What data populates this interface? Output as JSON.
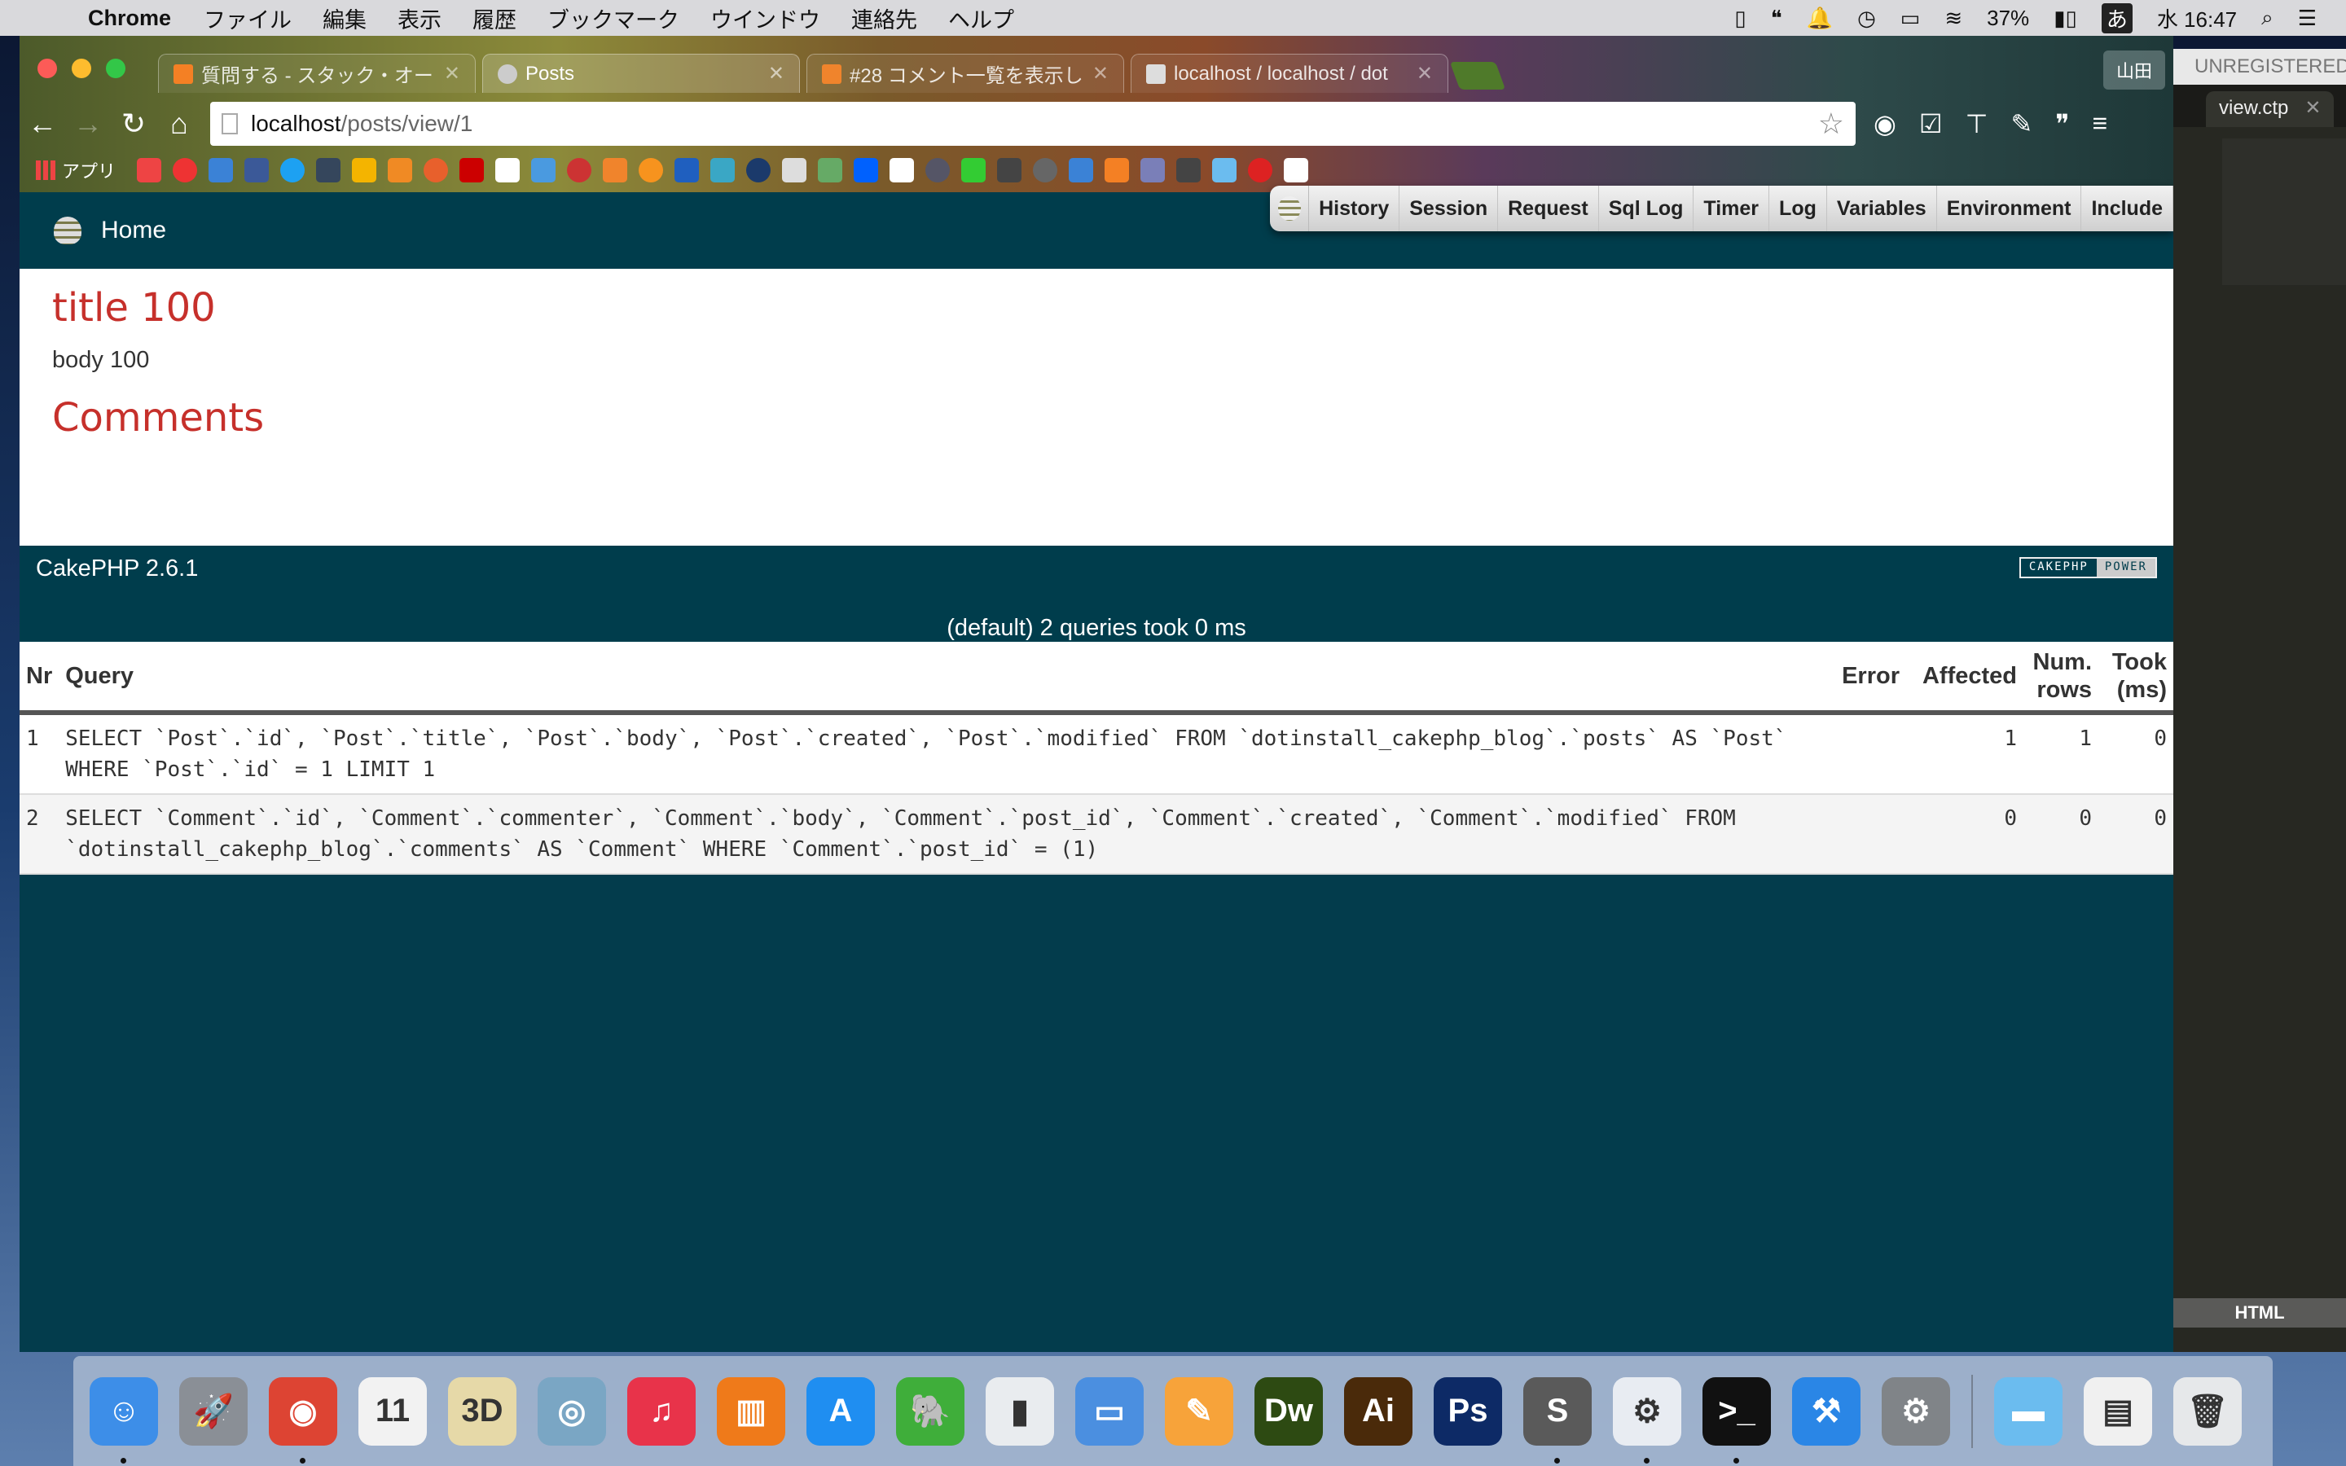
{
  "menubar": {
    "app_name": "Chrome",
    "items": [
      "ファイル",
      "編集",
      "表示",
      "履歴",
      "ブックマーク",
      "ウインドウ",
      "連絡先",
      "ヘルプ"
    ],
    "battery": "37%",
    "input_method": "あ",
    "clock": "水 16:47"
  },
  "browser": {
    "tabs": [
      {
        "title": "質問する - スタック・オー",
        "favicon_color": "#f48024",
        "active": false
      },
      {
        "title": "Posts",
        "favicon_color": "#cccccc",
        "active": true
      },
      {
        "title": "#28 コメント一覧を表示し",
        "favicon_color": "#f0842c",
        "active": false
      },
      {
        "title": "localhost / localhost / dot",
        "favicon_color": "#dddddd",
        "active": false
      }
    ],
    "profile_name": "山田",
    "url_host": "localhost",
    "url_path": "/posts/view/1",
    "bookmarks_apps_label": "アプリ"
  },
  "page": {
    "home_link": "Home",
    "debug_toolbar": [
      "History",
      "Session",
      "Request",
      "Sql Log",
      "Timer",
      "Log",
      "Variables",
      "Environment",
      "Include"
    ],
    "post_title": "title 100",
    "post_body": "body 100",
    "comments_heading": "Comments",
    "footer_version": "CakePHP 2.6.1",
    "power_badge": [
      "CAKEPHP",
      "POWER"
    ],
    "sql_summary": "(default) 2 queries took 0 ms",
    "sql_table": {
      "headers": [
        "Nr",
        "Query",
        "Error",
        "Affected",
        "Num. rows",
        "Took (ms)"
      ],
      "rows": [
        {
          "nr": "1",
          "query": "SELECT `Post`.`id`, `Post`.`title`, `Post`.`body`, `Post`.`created`, `Post`.`modified` FROM `dotinstall_cakephp_blog`.`posts` AS `Post` WHERE `Post`.`id` = 1 LIMIT 1",
          "error": "",
          "affected": "1",
          "num_rows": "1",
          "took": "0"
        },
        {
          "nr": "2",
          "query": "SELECT `Comment`.`id`, `Comment`.`commenter`, `Comment`.`body`, `Comment`.`post_id`, `Comment`.`created`, `Comment`.`modified` FROM `dotinstall_cakephp_blog`.`comments` AS `Comment` WHERE `Comment`.`post_id` = (1)",
          "error": "",
          "affected": "0",
          "num_rows": "0",
          "took": "0"
        }
      ]
    }
  },
  "editor": {
    "unregistered_label": "UNREGISTERED",
    "file_tab": "view.ctp",
    "syntax": "HTML"
  },
  "dock": {
    "apps": [
      {
        "name": "Finder",
        "icon": "finder-icon",
        "color": "#3d8ee8",
        "glyph": "☺",
        "running": true
      },
      {
        "name": "Launchpad",
        "icon": "launchpad-icon",
        "color": "#8a8f96",
        "glyph": "🚀",
        "running": false
      },
      {
        "name": "Chrome",
        "icon": "chrome-icon",
        "color": "#dd4433",
        "glyph": "◉",
        "running": true
      },
      {
        "name": "Calendar",
        "icon": "calendar-icon",
        "color": "#f2f2f2",
        "glyph": "11",
        "running": false
      },
      {
        "name": "Maps",
        "icon": "maps-icon",
        "color": "#e6d9a8",
        "glyph": "3D",
        "running": false
      },
      {
        "name": "Image Capture",
        "icon": "image-capture-icon",
        "color": "#7aa6c4",
        "glyph": "◎",
        "running": false
      },
      {
        "name": "iTunes",
        "icon": "itunes-icon",
        "color": "#e8334a",
        "glyph": "♫",
        "running": false
      },
      {
        "name": "iBooks",
        "icon": "ibooks-icon",
        "color": "#ef7a1a",
        "glyph": "▥",
        "running": false
      },
      {
        "name": "App Store",
        "icon": "app-store-icon",
        "color": "#1f8ef1",
        "glyph": "A",
        "running": false
      },
      {
        "name": "Evernote",
        "icon": "evernote-icon",
        "color": "#3fae3a",
        "glyph": "🐘",
        "running": false
      },
      {
        "name": "Numbers",
        "icon": "numbers-icon",
        "color": "#e9ecef",
        "glyph": "▮",
        "running": false
      },
      {
        "name": "Keynote",
        "icon": "keynote-icon",
        "color": "#4b8fe0",
        "glyph": "▭",
        "running": false
      },
      {
        "name": "Pages",
        "icon": "pages-icon",
        "color": "#f7a33a",
        "glyph": "✎",
        "running": false
      },
      {
        "name": "Dreamweaver",
        "icon": "dreamweaver-icon",
        "color": "#2d4a12",
        "glyph": "Dw",
        "running": false
      },
      {
        "name": "Illustrator",
        "icon": "illustrator-icon",
        "color": "#4a2a0a",
        "glyph": "Ai",
        "running": false
      },
      {
        "name": "Photoshop",
        "icon": "photoshop-icon",
        "color": "#0d2a66",
        "glyph": "Ps",
        "running": false
      },
      {
        "name": "Sublime Text",
        "icon": "sublime-text-icon",
        "color": "#5a5a5a",
        "glyph": "S",
        "running": true
      },
      {
        "name": "Automator Settings",
        "icon": "gear-app-icon",
        "color": "#e8ecf2",
        "glyph": "⚙",
        "running": true
      },
      {
        "name": "Terminal",
        "icon": "terminal-icon",
        "color": "#111111",
        "glyph": ">_",
        "running": true
      },
      {
        "name": "Xcode",
        "icon": "xcode-icon",
        "color": "#2a86e6",
        "glyph": "⚒",
        "running": false
      },
      {
        "name": "System Preferences",
        "icon": "system-preferences-icon",
        "color": "#808488",
        "glyph": "⚙",
        "running": false
      }
    ],
    "stacks": [
      {
        "name": "Documents",
        "icon": "folder-icon",
        "color": "#6bbcef",
        "glyph": "▬"
      },
      {
        "name": "Window Preview",
        "icon": "window-preview-icon",
        "color": "#f0f0f0",
        "glyph": "▤"
      },
      {
        "name": "Trash",
        "icon": "trash-icon",
        "color": "#e6e8ea",
        "glyph": "🗑"
      }
    ]
  }
}
